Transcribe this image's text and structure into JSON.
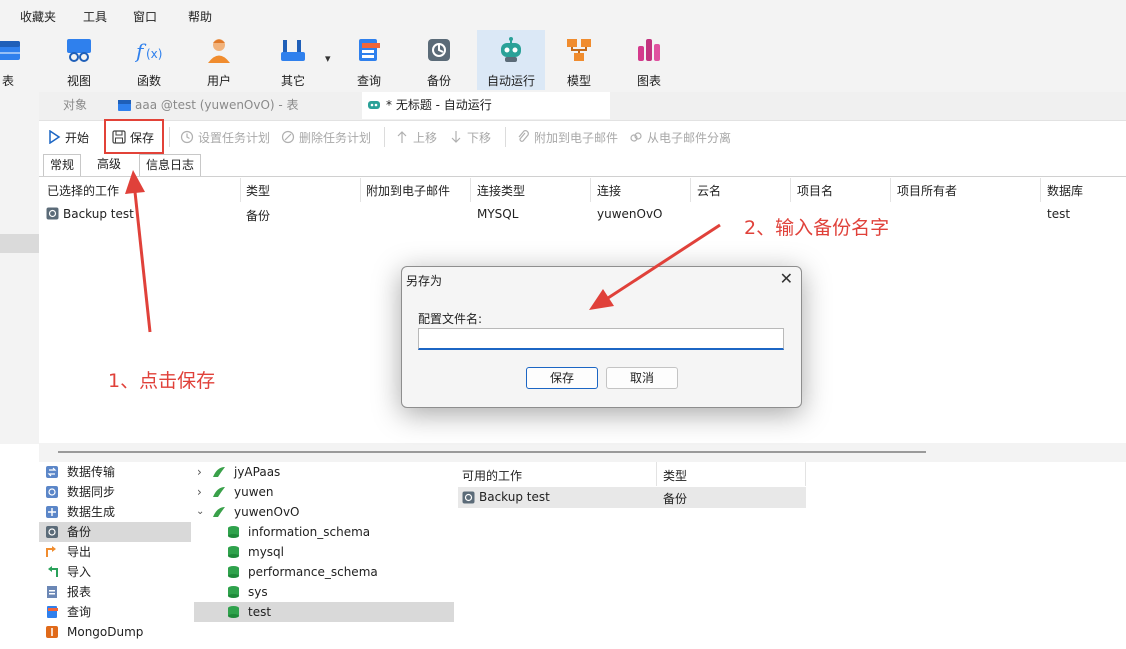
{
  "menu": {
    "items": [
      "收藏夹",
      "工具",
      "窗口",
      "帮助"
    ]
  },
  "ribbon": {
    "items": [
      {
        "label": "表",
        "icon": "table-icon"
      },
      {
        "label": "视图",
        "icon": "view-icon"
      },
      {
        "label": "函数",
        "icon": "function-icon"
      },
      {
        "label": "用户",
        "icon": "user-icon"
      },
      {
        "label": "其它",
        "icon": "tools-icon"
      },
      {
        "label": "查询",
        "icon": "query-icon"
      },
      {
        "label": "备份",
        "icon": "backup-icon"
      },
      {
        "label": "自动运行",
        "icon": "robot-icon"
      },
      {
        "label": "模型",
        "icon": "model-icon"
      },
      {
        "label": "图表",
        "icon": "chart-icon"
      }
    ],
    "dropdown_glyph": "▾"
  },
  "tabs": {
    "objects": "对象",
    "table_tab": "aaa @test (yuwenOvO) - 表",
    "active_tab": "* 无标题 - 自动运行"
  },
  "toolbar": {
    "start": "开始",
    "save": "保存",
    "set_schedule": "设置任务计划",
    "delete_schedule": "删除任务计划",
    "move_up": "上移",
    "move_down": "下移",
    "attach_email": "附加到电子邮件",
    "detach_email": "从电子邮件分离"
  },
  "subtabs": [
    "常规",
    "高级",
    "信息日志"
  ],
  "grid": {
    "headers": [
      "已选择的工作",
      "类型",
      "附加到电子邮件",
      "连接类型",
      "连接",
      "云名",
      "项目名",
      "项目所有者",
      "数据库"
    ],
    "rows": [
      [
        "Backup test",
        "备份",
        "",
        "MYSQL",
        "yuwenOvO",
        "",
        "",
        "",
        "test"
      ]
    ]
  },
  "job_types": [
    {
      "label": "数据传输",
      "icon": "transfer-icon"
    },
    {
      "label": "数据同步",
      "icon": "sync-icon"
    },
    {
      "label": "数据生成",
      "icon": "generate-icon"
    },
    {
      "label": "备份",
      "icon": "backup-icon",
      "selected": true
    },
    {
      "label": "导出",
      "icon": "export-icon"
    },
    {
      "label": "导入",
      "icon": "import-icon"
    },
    {
      "label": "报表",
      "icon": "report-icon"
    },
    {
      "label": "查询",
      "icon": "query-icon"
    },
    {
      "label": "MongoDump",
      "icon": "mongodump-icon"
    }
  ],
  "connections": [
    {
      "label": "jyAPaas",
      "level": 0,
      "expanded": false
    },
    {
      "label": "yuwen",
      "level": 0,
      "expanded": false
    },
    {
      "label": "yuwenOvO",
      "level": 0,
      "expanded": true
    },
    {
      "label": "information_schema",
      "level": 1
    },
    {
      "label": "mysql",
      "level": 1
    },
    {
      "label": "performance_schema",
      "level": 1
    },
    {
      "label": "sys",
      "level": 1
    },
    {
      "label": "test",
      "level": 1,
      "selected": true
    }
  ],
  "available": {
    "headers": [
      "可用的工作",
      "类型"
    ],
    "rows": [
      [
        "Backup test",
        "备份"
      ]
    ]
  },
  "dialog": {
    "title": "另存为",
    "close": "✕",
    "label": "配置文件名:",
    "value": "",
    "save": "保存",
    "cancel": "取消"
  },
  "annotations": {
    "step1": "1、点击保存",
    "step2": "2、输入备份名字",
    "color": "#e0413a"
  }
}
